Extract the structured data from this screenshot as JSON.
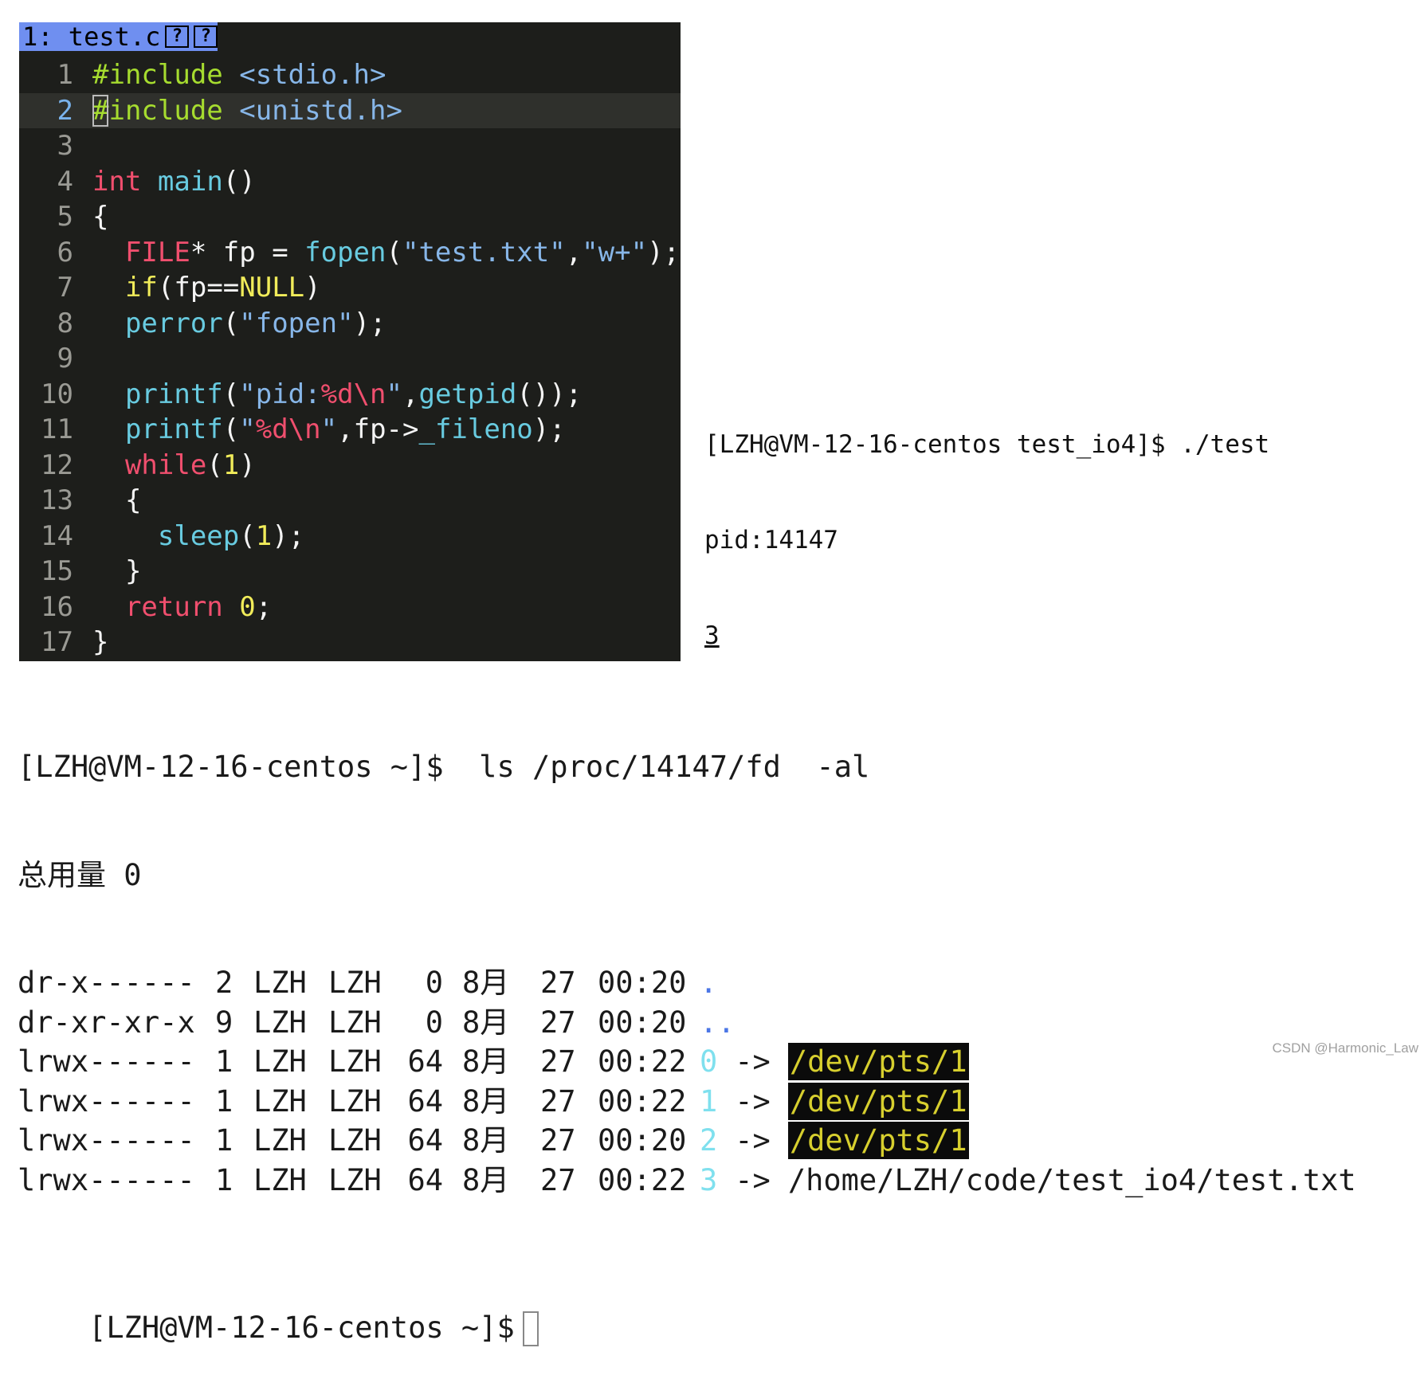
{
  "editor": {
    "tab_label": "1: test.c",
    "tab_icons": [
      "?",
      "?"
    ],
    "cursor_line": 2,
    "lines": [
      {
        "n": "1",
        "tokens": [
          {
            "t": "#include",
            "c": "kw-grn"
          },
          {
            "t": " ",
            "c": "plain"
          },
          {
            "t": "<stdio.h>",
            "c": "str-b"
          }
        ]
      },
      {
        "n": "2",
        "tokens": [
          {
            "t": "#",
            "c": "kw-grn cursor"
          },
          {
            "t": "include",
            "c": "kw-grn"
          },
          {
            "t": " ",
            "c": "plain"
          },
          {
            "t": "<unistd.h>",
            "c": "str-b"
          }
        ]
      },
      {
        "n": "3",
        "tokens": []
      },
      {
        "n": "4",
        "tokens": [
          {
            "t": "int",
            "c": "kw-red"
          },
          {
            "t": " ",
            "c": "plain"
          },
          {
            "t": "main",
            "c": "fn"
          },
          {
            "t": "()",
            "c": "plain"
          }
        ]
      },
      {
        "n": "5",
        "tokens": [
          {
            "t": "{",
            "c": "plain"
          }
        ]
      },
      {
        "n": "6",
        "tokens": [
          {
            "t": "  ",
            "c": "plain"
          },
          {
            "t": "FILE",
            "c": "kw-red"
          },
          {
            "t": "* fp = ",
            "c": "plain"
          },
          {
            "t": "fopen",
            "c": "fn"
          },
          {
            "t": "(",
            "c": "plain"
          },
          {
            "t": "\"test.txt\"",
            "c": "str-b"
          },
          {
            "t": ",",
            "c": "plain"
          },
          {
            "t": "\"w+\"",
            "c": "str-b"
          },
          {
            "t": ");",
            "c": "plain"
          }
        ]
      },
      {
        "n": "7",
        "tokens": [
          {
            "t": "  ",
            "c": "plain"
          },
          {
            "t": "if",
            "c": "num"
          },
          {
            "t": "(fp==",
            "c": "plain"
          },
          {
            "t": "NULL",
            "c": "nul"
          },
          {
            "t": ")",
            "c": "plain"
          }
        ]
      },
      {
        "n": "8",
        "tokens": [
          {
            "t": "  ",
            "c": "plain"
          },
          {
            "t": "perror",
            "c": "fn"
          },
          {
            "t": "(",
            "c": "plain"
          },
          {
            "t": "\"fopen\"",
            "c": "str-b"
          },
          {
            "t": ");",
            "c": "plain"
          }
        ]
      },
      {
        "n": "9",
        "tokens": []
      },
      {
        "n": "10",
        "tokens": [
          {
            "t": "  ",
            "c": "plain"
          },
          {
            "t": "printf",
            "c": "fn"
          },
          {
            "t": "(",
            "c": "plain"
          },
          {
            "t": "\"pid:",
            "c": "str-b"
          },
          {
            "t": "%d\\n",
            "c": "esc"
          },
          {
            "t": "\"",
            "c": "str-b"
          },
          {
            "t": ",",
            "c": "plain"
          },
          {
            "t": "getpid",
            "c": "fn"
          },
          {
            "t": "());",
            "c": "plain"
          }
        ]
      },
      {
        "n": "11",
        "tokens": [
          {
            "t": "  ",
            "c": "plain"
          },
          {
            "t": "printf",
            "c": "fn"
          },
          {
            "t": "(",
            "c": "plain"
          },
          {
            "t": "\"",
            "c": "str-b"
          },
          {
            "t": "%d\\n",
            "c": "esc"
          },
          {
            "t": "\"",
            "c": "str-b"
          },
          {
            "t": ",fp->",
            "c": "plain"
          },
          {
            "t": "_fileno",
            "c": "fn"
          },
          {
            "t": ");",
            "c": "plain"
          }
        ]
      },
      {
        "n": "12",
        "tokens": [
          {
            "t": "  ",
            "c": "plain"
          },
          {
            "t": "while",
            "c": "kw-red"
          },
          {
            "t": "(",
            "c": "plain"
          },
          {
            "t": "1",
            "c": "num"
          },
          {
            "t": ")",
            "c": "plain"
          }
        ]
      },
      {
        "n": "13",
        "tokens": [
          {
            "t": "  {",
            "c": "plain"
          }
        ]
      },
      {
        "n": "14",
        "tokens": [
          {
            "t": "    ",
            "c": "plain"
          },
          {
            "t": "sleep",
            "c": "fn"
          },
          {
            "t": "(",
            "c": "plain"
          },
          {
            "t": "1",
            "c": "num"
          },
          {
            "t": ");",
            "c": "plain"
          }
        ]
      },
      {
        "n": "15",
        "tokens": [
          {
            "t": "  }",
            "c": "plain"
          }
        ]
      },
      {
        "n": "16",
        "tokens": [
          {
            "t": "  ",
            "c": "plain"
          },
          {
            "t": "return",
            "c": "kw-red"
          },
          {
            "t": " ",
            "c": "plain"
          },
          {
            "t": "0",
            "c": "num"
          },
          {
            "t": ";",
            "c": "plain"
          }
        ]
      },
      {
        "n": "17",
        "tokens": [
          {
            "t": "}",
            "c": "plain"
          }
        ]
      }
    ]
  },
  "run_terminal": {
    "prompt_line": "[LZH@VM-12-16-centos test_io4]$ ./test",
    "output_pid": "pid:14147",
    "output_fd": "3"
  },
  "fd_terminal": {
    "command_line": "[LZH@VM-12-16-centos ~]$  ls /proc/14147/fd  -al",
    "total_line": "总用量 0",
    "entries": [
      {
        "perm": "dr-x------",
        "links": "2",
        "user": "LZH",
        "group": "LZH",
        "size": "0",
        "month": "8月",
        "day": "27",
        "time": "00:20",
        "name": ".",
        "name_style": "dot-blue",
        "arrow": "",
        "target": "",
        "target_style": ""
      },
      {
        "perm": "dr-xr-xr-x",
        "links": "9",
        "user": "LZH",
        "group": "LZH",
        "size": "0",
        "month": "8月",
        "day": "27",
        "time": "00:20",
        "name": "..",
        "name_style": "dot-blue",
        "arrow": "",
        "target": "",
        "target_style": ""
      },
      {
        "perm": "lrwx------",
        "links": "1",
        "user": "LZH",
        "group": "LZH",
        "size": "64",
        "month": "8月",
        "day": "27",
        "time": "00:22",
        "name": "0",
        "name_style": "fd-cyan",
        "arrow": "->",
        "target": "/dev/pts/1",
        "target_style": "target-hl"
      },
      {
        "perm": "lrwx------",
        "links": "1",
        "user": "LZH",
        "group": "LZH",
        "size": "64",
        "month": "8月",
        "day": "27",
        "time": "00:22",
        "name": "1",
        "name_style": "fd-cyan",
        "arrow": "->",
        "target": "/dev/pts/1",
        "target_style": "target-hl"
      },
      {
        "perm": "lrwx------",
        "links": "1",
        "user": "LZH",
        "group": "LZH",
        "size": "64",
        "month": "8月",
        "day": "27",
        "time": "00:20",
        "name": "2",
        "name_style": "fd-cyan",
        "arrow": "->",
        "target": "/dev/pts/1",
        "target_style": "target-hl"
      },
      {
        "perm": "lrwx------",
        "links": "1",
        "user": "LZH",
        "group": "LZH",
        "size": "64",
        "month": "8月",
        "day": "27",
        "time": "00:22",
        "name": "3",
        "name_style": "fd-cyan",
        "arrow": "->",
        "target": "/home/LZH/code/test_io4/test.txt",
        "target_style": "target-plain"
      }
    ],
    "final_prompt": "[LZH@VM-12-16-centos ~]$"
  },
  "watermark": "CSDN @Harmonic_Law"
}
